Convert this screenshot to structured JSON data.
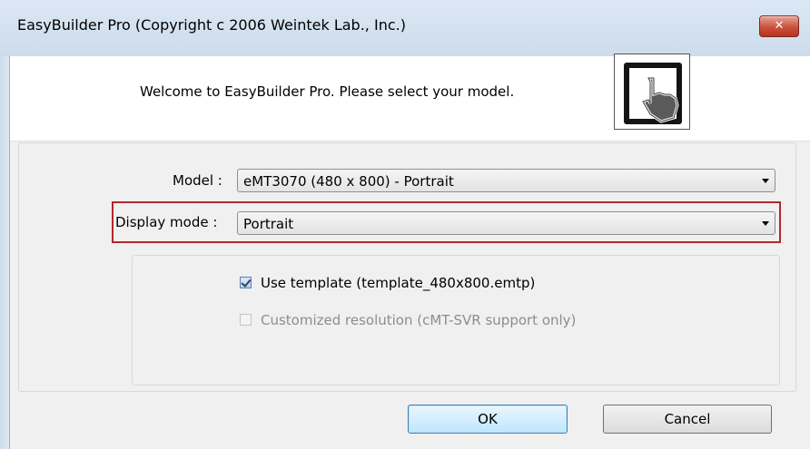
{
  "window": {
    "title": "EasyBuilder Pro (Copyright c 2006  Weintek Lab., Inc.)",
    "close_glyph": "✕"
  },
  "header": {
    "welcome_text": "Welcome to EasyBuilder Pro. Please select your model.",
    "logo_icon": "hand-pointer-logo-icon"
  },
  "form": {
    "model_label": "Model :",
    "model_value": "eMT3070 (480 x 800) - Portrait",
    "display_mode_label": "Display mode :",
    "display_mode_value": "Portrait",
    "highlight_color": "#b3272d"
  },
  "options": {
    "use_template_label": "Use template (template_480x800.emtp)",
    "use_template_checked": true,
    "customized_resolution_label": "Customized resolution (cMT-SVR support only)",
    "customized_resolution_checked": false,
    "customized_resolution_enabled": false
  },
  "buttons": {
    "ok_label": "OK",
    "cancel_label": "Cancel"
  }
}
